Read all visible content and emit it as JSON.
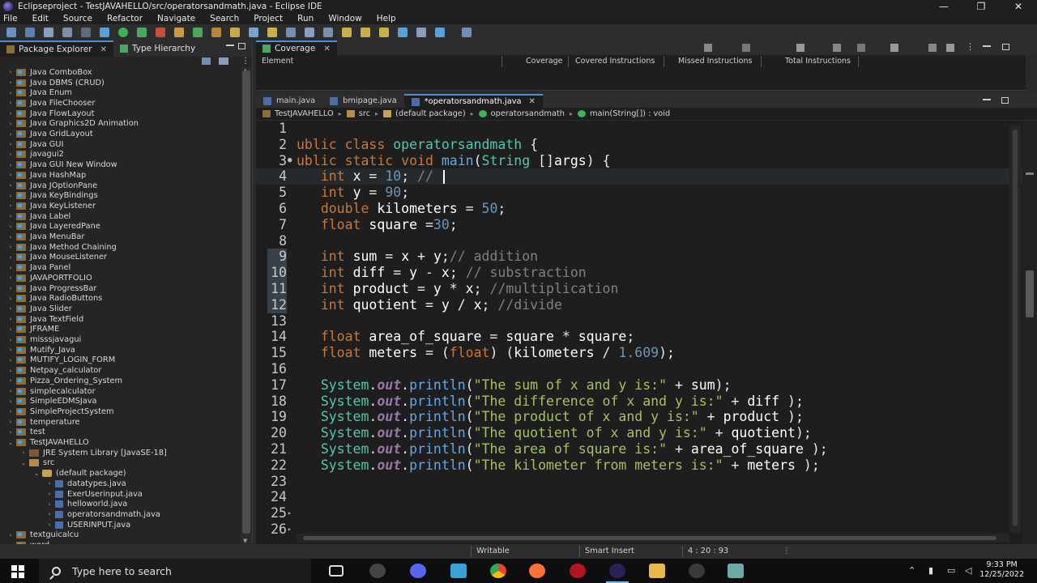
{
  "window": {
    "title": "Eclipseproject - TestJAVAHELLO/src/operatorsandmath.java - Eclipse IDE",
    "minimize": "—",
    "restore": "❐",
    "close": "✕"
  },
  "menu": [
    "File",
    "Edit",
    "Source",
    "Refactor",
    "Navigate",
    "Search",
    "Project",
    "Run",
    "Window",
    "Help"
  ],
  "left_panel": {
    "tabs": [
      {
        "label": "Package Explorer",
        "close": "✕"
      },
      {
        "label": "Type Hierarchy"
      }
    ],
    "tree": [
      {
        "label": "Java ComboBox",
        "kind": "project",
        "arrow": "›"
      },
      {
        "label": "Java DBMS (CRUD)",
        "kind": "project",
        "arrow": "›"
      },
      {
        "label": "Java Enum",
        "kind": "project",
        "arrow": "›"
      },
      {
        "label": "Java FileChooser",
        "kind": "project",
        "arrow": "›"
      },
      {
        "label": "Java FlowLayout",
        "kind": "project",
        "arrow": "›"
      },
      {
        "label": "Java Graphics2D Animation",
        "kind": "project",
        "arrow": "›"
      },
      {
        "label": "Java GridLayout",
        "kind": "project",
        "arrow": "›"
      },
      {
        "label": "Java GUI",
        "kind": "project",
        "arrow": "›"
      },
      {
        "label": "javagui2",
        "kind": "project",
        "arrow": "›"
      },
      {
        "label": "Java GUI New Window",
        "kind": "project",
        "arrow": "›"
      },
      {
        "label": "Java HashMap",
        "kind": "project",
        "arrow": "›"
      },
      {
        "label": "Java JOptionPane",
        "kind": "project",
        "arrow": "›"
      },
      {
        "label": "Java KeyBindings",
        "kind": "project",
        "arrow": "›"
      },
      {
        "label": "Java KeyListener",
        "kind": "project",
        "arrow": "›"
      },
      {
        "label": "Java Label",
        "kind": "project",
        "arrow": "›"
      },
      {
        "label": "Java LayeredPane",
        "kind": "project",
        "arrow": "›"
      },
      {
        "label": "Java MenuBar",
        "kind": "project",
        "arrow": "›"
      },
      {
        "label": "Java Method Chaining",
        "kind": "project",
        "arrow": "›"
      },
      {
        "label": "Java MouseListener",
        "kind": "project",
        "arrow": "›"
      },
      {
        "label": "Java Panel",
        "kind": "project",
        "arrow": "›"
      },
      {
        "label": "JAVAPORTFOLIO",
        "kind": "project",
        "arrow": "›"
      },
      {
        "label": "Java ProgressBar",
        "kind": "project",
        "arrow": "›"
      },
      {
        "label": "Java RadioButtons",
        "kind": "project",
        "arrow": "›"
      },
      {
        "label": "Java Slider",
        "kind": "project",
        "arrow": "›"
      },
      {
        "label": "Java TextField",
        "kind": "project",
        "arrow": "›"
      },
      {
        "label": "JFRAME",
        "kind": "project",
        "arrow": "›"
      },
      {
        "label": "misssjavagui",
        "kind": "project",
        "arrow": "›"
      },
      {
        "label": "Mutify_Java",
        "kind": "project",
        "arrow": "›"
      },
      {
        "label": "MUTIFY_LOGIN_FORM",
        "kind": "project",
        "arrow": "›"
      },
      {
        "label": "Netpay_calculator",
        "kind": "project",
        "arrow": "›"
      },
      {
        "label": "Pizza_Ordering_System",
        "kind": "project",
        "arrow": "›"
      },
      {
        "label": "simplecalculator",
        "kind": "project",
        "arrow": "›"
      },
      {
        "label": "SimpleEDMSJava",
        "kind": "project",
        "arrow": "›"
      },
      {
        "label": "SimpleProjectSystem",
        "kind": "project",
        "arrow": "›"
      },
      {
        "label": "temperature",
        "kind": "project",
        "arrow": "›"
      },
      {
        "label": "test",
        "kind": "project",
        "arrow": "›"
      },
      {
        "label": "TestJAVAHELLO",
        "kind": "project",
        "arrow": "⌄"
      },
      {
        "label": "JRE System Library [JavaSE-18]",
        "kind": "library",
        "arrow": "›"
      },
      {
        "label": "src",
        "kind": "src",
        "arrow": "⌄"
      },
      {
        "label": "(default package)",
        "kind": "package",
        "arrow": "⌄"
      },
      {
        "label": "datatypes.java",
        "kind": "java",
        "arrow": "›"
      },
      {
        "label": "ExerUserinput.java",
        "kind": "java",
        "arrow": "›"
      },
      {
        "label": "helloworld.java",
        "kind": "java",
        "arrow": "›"
      },
      {
        "label": "operatorsandmath.java",
        "kind": "java",
        "arrow": "›"
      },
      {
        "label": "USERINPUT.java",
        "kind": "java",
        "arrow": "›"
      },
      {
        "label": "textguicalcu",
        "kind": "project",
        "arrow": "›"
      },
      {
        "label": "word",
        "kind": "project",
        "arrow": "›"
      }
    ]
  },
  "coverage": {
    "tab_label": "Coverage",
    "close": "✕",
    "columns": [
      "Element",
      "Coverage",
      "Covered Instructions",
      "Missed Instructions",
      "Total Instructions"
    ]
  },
  "editor": {
    "tabs": [
      {
        "label": "main.java"
      },
      {
        "label": "bmipage.java"
      },
      {
        "label": "*operatorsandmath.java",
        "close": "✕"
      }
    ],
    "breadcrumb": [
      "TestJAVAHELLO",
      "src",
      "(default package)",
      "operatorsandmath",
      "main(String[]) : void"
    ],
    "lines": [
      {
        "n": "1",
        "code": ""
      },
      {
        "n": "2",
        "code": "public class operatorsandmath {"
      },
      {
        "n": "3",
        "code": "public static void main(String []args) {"
      },
      {
        "n": "4",
        "code": "    int x = 10; // "
      },
      {
        "n": "5",
        "code": "    int y = 90;"
      },
      {
        "n": "6",
        "code": "    double kilometers = 50;"
      },
      {
        "n": "7",
        "code": "    float square =30;"
      },
      {
        "n": "8",
        "code": ""
      },
      {
        "n": "9",
        "code": "    int sum = x + y;// addition"
      },
      {
        "n": "10",
        "code": "    int diff = y - x; // substraction"
      },
      {
        "n": "11",
        "code": "    int product = y * x; //multiplication"
      },
      {
        "n": "12",
        "code": "    int quotient = y / x; //divide"
      },
      {
        "n": "13",
        "code": ""
      },
      {
        "n": "14",
        "code": "    float area_of_square = square * square;"
      },
      {
        "n": "15",
        "code": "    float meters = (float) (kilometers / 1.609);"
      },
      {
        "n": "16",
        "code": ""
      },
      {
        "n": "17",
        "code": "    System.out.println(\"The sum of x and y is:\" + sum);"
      },
      {
        "n": "18",
        "code": "    System.out.println(\"The difference of x and y is:\" + diff );"
      },
      {
        "n": "19",
        "code": "    System.out.println(\"The product of x and y is:\" + product );"
      },
      {
        "n": "20",
        "code": "    System.out.println(\"The quotient of x and y is:\" + quotient);"
      },
      {
        "n": "21",
        "code": "    System.out.println(\"The area of square is:\" + area_of_square );"
      },
      {
        "n": "22",
        "code": "    System.out.println(\"The kilometer from meters is:\" + meters );"
      },
      {
        "n": "23",
        "code": ""
      },
      {
        "n": "24",
        "code": ""
      },
      {
        "n": "25",
        "code": ""
      },
      {
        "n": "26",
        "code": ""
      }
    ]
  },
  "status": {
    "writable": "Writable",
    "insert_mode": "Smart Insert",
    "position": "4 : 20 : 93"
  },
  "taskbar": {
    "search_placeholder": "Type here to search",
    "time": "9:33 PM",
    "date": "12/25/2022"
  },
  "colors": {
    "accent": "#4a90d9",
    "keyword": "#cc7832",
    "string": "#a5c25c",
    "comment": "#808080",
    "number": "#6897bb"
  }
}
